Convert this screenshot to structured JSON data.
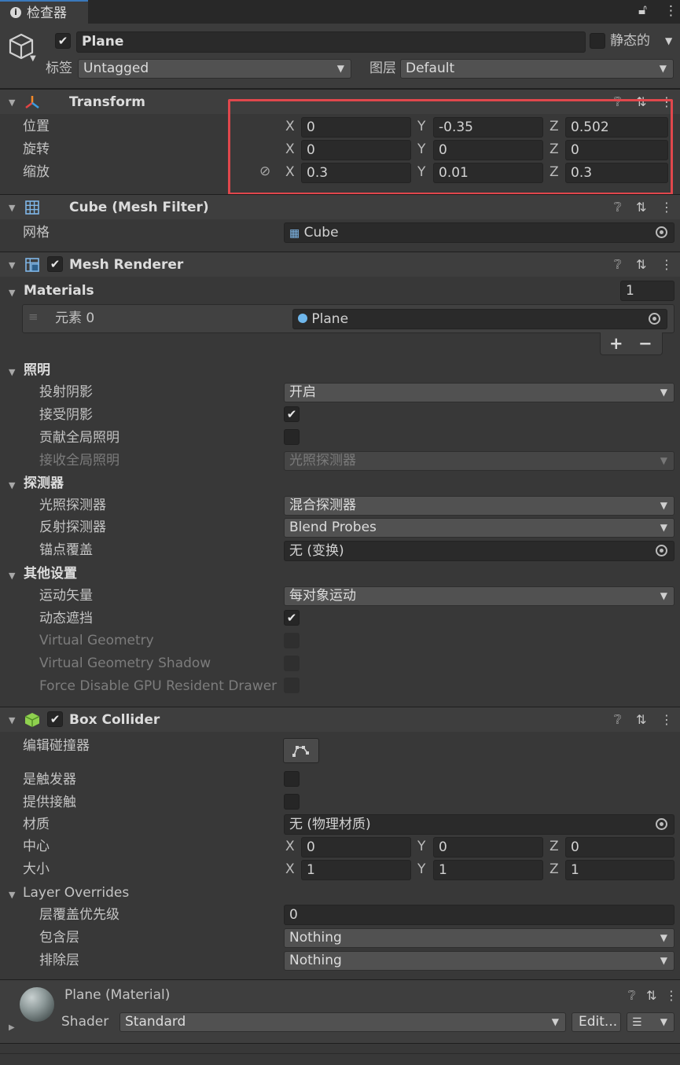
{
  "window": {
    "tab_title": "检查器"
  },
  "object": {
    "name": "Plane",
    "static_label": "静态的",
    "tag_label": "标签",
    "tag_value": "Untagged",
    "layer_label": "图层",
    "layer_value": "Default"
  },
  "transform": {
    "title": "Transform",
    "rows": [
      {
        "label": "位置",
        "x": "0",
        "y": "-0.35",
        "z": "0.502"
      },
      {
        "label": "旋转",
        "x": "0",
        "y": "0",
        "z": "0"
      },
      {
        "label": "缩放",
        "x": "0.3",
        "y": "0.01",
        "z": "0.3"
      }
    ],
    "highlight_color": "#e0474c"
  },
  "axes": {
    "x": "X",
    "y": "Y",
    "z": "Z"
  },
  "mesh_filter": {
    "title": "Cube (Mesh Filter)",
    "mesh_label": "网格",
    "mesh_value": "Cube"
  },
  "mesh_renderer": {
    "title": "Mesh Renderer",
    "materials_label": "Materials",
    "materials_count": "1",
    "element_label": "元素 0",
    "element_value": "Plane",
    "add": "+",
    "remove": "−",
    "lighting": {
      "title": "照明",
      "cast_shadows_label": "投射阴影",
      "cast_shadows_value": "开启",
      "receive_shadows_label": "接受阴影",
      "contribute_gi_label": "贡献全局照明",
      "receive_gi_label": "接收全局照明",
      "receive_gi_value": "光照探测器"
    },
    "probes": {
      "title": "探测器",
      "light_probes_label": "光照探测器",
      "light_probes_value": "混合探测器",
      "reflection_probes_label": "反射探测器",
      "reflection_probes_value": "Blend Probes",
      "anchor_label": "锚点覆盖",
      "anchor_value": "无 (变换)"
    },
    "other": {
      "title": "其他设置",
      "motion_label": "运动矢量",
      "motion_value": "每对象运动",
      "dynamic_occlusion_label": "动态遮挡",
      "vg_label": "Virtual Geometry",
      "vg_shadow_label": "Virtual Geometry Shadow",
      "gpu_label": "Force Disable GPU Resident Drawer"
    }
  },
  "box_collider": {
    "title": "Box Collider",
    "edit_label": "编辑碰撞器",
    "trigger_label": "是触发器",
    "contacts_label": "提供接触",
    "material_label": "材质",
    "material_value": "无 (物理材质)",
    "center_label": "中心",
    "center": {
      "x": "0",
      "y": "0",
      "z": "0"
    },
    "size_label": "大小",
    "size": {
      "x": "1",
      "y": "1",
      "z": "1"
    },
    "layer_overrides": {
      "title": "Layer Overrides",
      "priority_label": "层覆盖优先级",
      "priority_value": "0",
      "include_label": "包含层",
      "include_value": "Nothing",
      "exclude_label": "排除层",
      "exclude_value": "Nothing"
    }
  },
  "material": {
    "title": "Plane (Material)",
    "shader_label": "Shader",
    "shader_value": "Standard",
    "edit_button": "Edit..."
  }
}
